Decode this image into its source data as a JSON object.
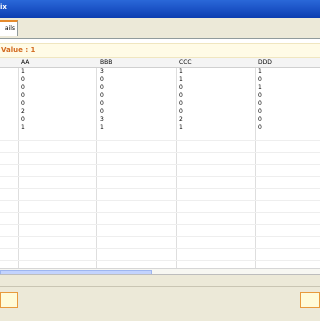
{
  "window": {
    "title_fragment": "ix"
  },
  "tabs": [
    {
      "label": "ails"
    }
  ],
  "value_banner": {
    "text": "Value : 1"
  },
  "table": {
    "columns": [
      "AA",
      "BBB",
      "CCC",
      "DDD"
    ],
    "rows": [
      [
        "1",
        "3",
        "1",
        "1"
      ],
      [
        "0",
        "0",
        "1",
        "0"
      ],
      [
        "0",
        "0",
        "0",
        "1"
      ],
      [
        "0",
        "0",
        "0",
        "0"
      ],
      [
        "0",
        "0",
        "0",
        "0"
      ],
      [
        "2",
        "0",
        "0",
        "0"
      ],
      [
        "0",
        "3",
        "2",
        "0"
      ],
      [
        "1",
        "1",
        "1",
        "0"
      ]
    ]
  },
  "colors": {
    "accent": "#e68b2c",
    "value_text": "#d2691e",
    "title_bar": "#1d55c8"
  }
}
